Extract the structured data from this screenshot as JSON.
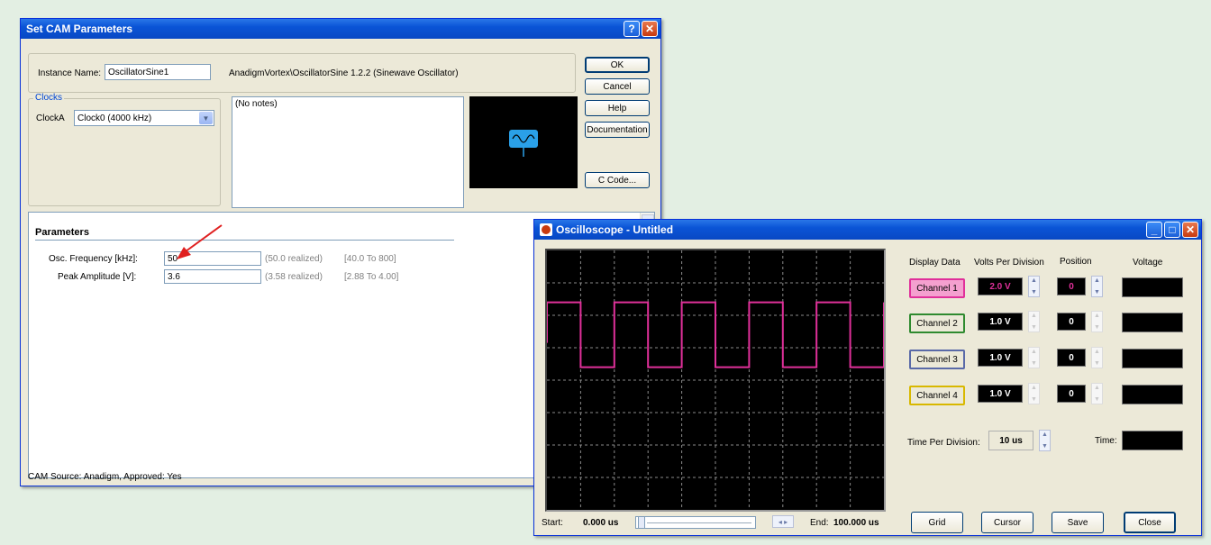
{
  "cam": {
    "title": "Set CAM Parameters",
    "title_buttons": {
      "help": "?",
      "close": "✕"
    },
    "instance_label": "Instance Name:",
    "instance_value": "OscillatorSine1",
    "cam_path": "AnadigmVortex\\OscillatorSine 1.2.2 (Sinewave Oscillator)",
    "clocks_title": "Clocks",
    "clock_label": "ClockA",
    "clock_value": "Clock0  (4000 kHz)",
    "notes": "(No notes)",
    "buttons": {
      "ok": "OK",
      "cancel": "Cancel",
      "help": "Help",
      "documentation": "Documentation",
      "ccode": "C Code..."
    },
    "params_title": "Parameters",
    "params": [
      {
        "label": "Osc. Frequency [kHz]:",
        "value": "50",
        "realized": "(50.0 realized)",
        "range": "[40.0 To 800]"
      },
      {
        "label": "Peak Amplitude [V]:",
        "value": "3.6",
        "realized": "(3.58 realized)",
        "range": "[2.88 To 4.00]"
      }
    ],
    "status": "CAM Source: Anadigm, Approved: Yes",
    "colors": {
      "arrow": "#e02020",
      "preview_icon": "#2aa0e8"
    }
  },
  "osc": {
    "title": "Oscilloscope - Untitled",
    "title_buttons": {
      "min": "_",
      "max": "□",
      "close": "✕"
    },
    "headers": {
      "display": "Display Data",
      "volts": "Volts Per Division",
      "position": "Position",
      "voltage": "Voltage"
    },
    "channels": [
      {
        "label": "Channel 1",
        "vpd": "2.0 V",
        "pos": "0",
        "color": "#e0309a"
      },
      {
        "label": "Channel 2",
        "vpd": "1.0 V",
        "pos": "0",
        "color": "#2f8a2f"
      },
      {
        "label": "Channel 3",
        "vpd": "1.0 V",
        "pos": "0",
        "color": "#5a6aa8"
      },
      {
        "label": "Channel 4",
        "vpd": "1.0 V",
        "pos": "0",
        "color": "#d8b800"
      }
    ],
    "tpd_label": "Time Per Division:",
    "tpd_value": "10 us",
    "time_label": "Time:",
    "start_label": "Start:",
    "start_value": "0.000 us",
    "end_label": "End:",
    "end_value": "100.000 us",
    "scroll_arrows": "◂ ▸",
    "buttons": {
      "grid": "Grid",
      "cursor": "Cursor",
      "save": "Save",
      "close": "Close"
    },
    "trace_color": "#e0309a"
  }
}
